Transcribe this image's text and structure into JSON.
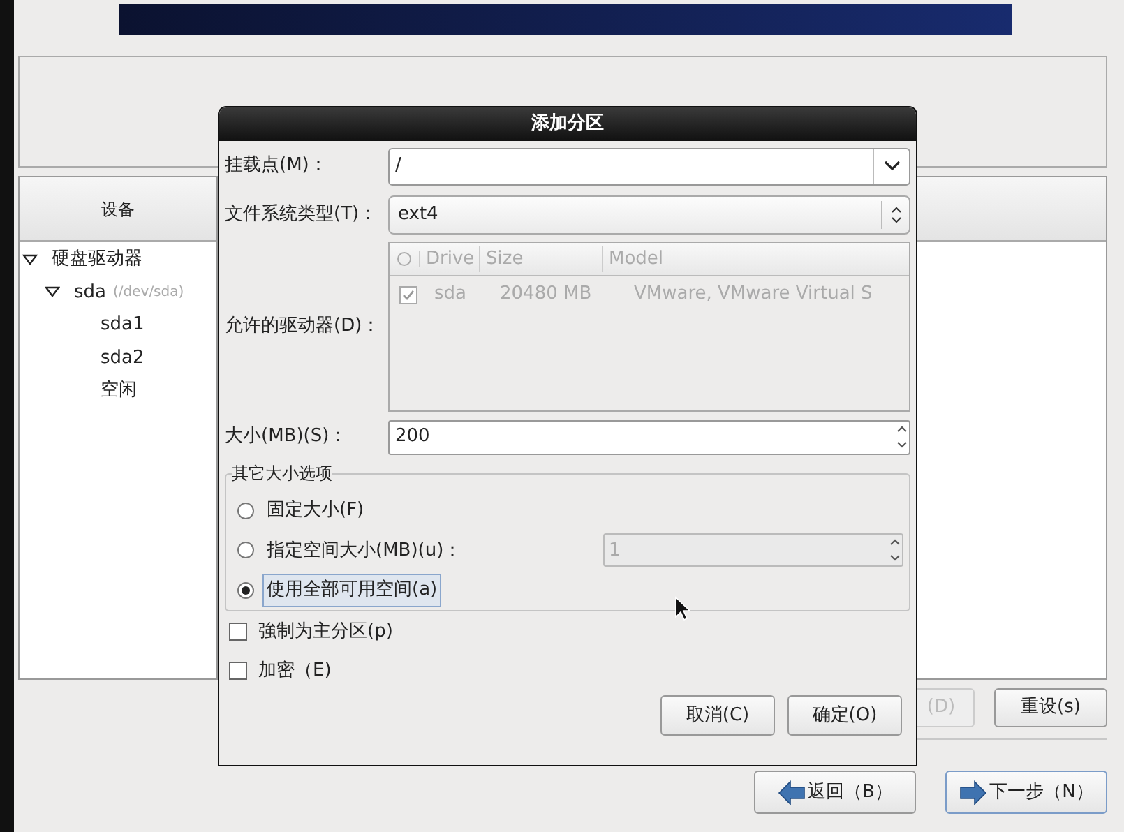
{
  "device_panel": {
    "column_header": "设备",
    "tree": [
      {
        "label": "硬盘驱动器",
        "expanded": true,
        "children": [
          {
            "label": "sda",
            "path": "(/dev/sda)",
            "expanded": true,
            "children": [
              {
                "label": "sda1"
              },
              {
                "label": "sda2"
              },
              {
                "label": "空闲"
              }
            ]
          }
        ]
      }
    ]
  },
  "panel_buttons": [
    {
      "label": "(D)",
      "disabled": true
    },
    {
      "label": "重设(s)",
      "disabled": false
    }
  ],
  "nav_buttons": [
    {
      "label": "返回（B）",
      "kind": "back"
    },
    {
      "label": "下一步（N）",
      "kind": "next"
    }
  ],
  "dialog": {
    "title": "添加分区",
    "mount_point": {
      "label": "挂载点(M)：",
      "value": "/"
    },
    "fs_type": {
      "label": "文件系统类型(T)：",
      "value": "ext4"
    },
    "drives": {
      "label": "允许的驱动器(D)：",
      "columns": [
        "Drive",
        "Size",
        "Model"
      ],
      "rows": [
        {
          "checked": true,
          "cells": [
            "sda",
            "20480 MB",
            "VMware, VMware Virtual S"
          ]
        }
      ]
    },
    "size": {
      "label": "大小(MB)(S)：",
      "value": "200"
    },
    "size_options": {
      "title": "其它大小选项",
      "options": [
        {
          "label": "固定大小(F)",
          "selected": false,
          "kind": "plain"
        },
        {
          "label": "指定空间大小(MB)(u)：",
          "selected": false,
          "kind": "with_field",
          "value": "1"
        },
        {
          "label": "使用全部可用空间(a)",
          "selected": true,
          "kind": "plain"
        }
      ]
    },
    "checkboxes": [
      {
        "label": "強制为主分区(p)",
        "checked": false
      },
      {
        "label": "加密（E)",
        "checked": false
      }
    ],
    "buttons": [
      "取消(C)",
      "确定(O)"
    ]
  }
}
